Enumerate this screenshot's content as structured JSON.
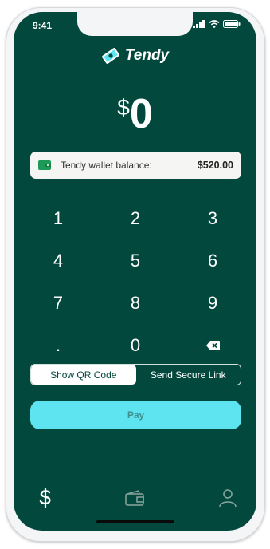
{
  "status_bar": {
    "time": "9:41"
  },
  "brand": {
    "name": "Tendy",
    "logo_icon": "dollar-note-icon"
  },
  "amount": {
    "currency_symbol": "$",
    "value": "0"
  },
  "wallet": {
    "label": "Tendy wallet balance:",
    "balance": "$520.00",
    "icon": "wallet-icon"
  },
  "keypad": {
    "keys": [
      "1",
      "2",
      "3",
      "4",
      "5",
      "6",
      "7",
      "8",
      "9",
      ".",
      "0"
    ],
    "delete_icon": "backspace-icon"
  },
  "payment_method": {
    "options": [
      "Show QR Code",
      "Send Secure Link"
    ],
    "selected": "Show QR Code"
  },
  "pay_button": {
    "label": "Pay"
  },
  "tab_bar": {
    "tabs": [
      {
        "name": "pay",
        "icon": "dollar-icon",
        "active": true
      },
      {
        "name": "wallet",
        "icon": "wallet-icon",
        "active": false
      },
      {
        "name": "profile",
        "icon": "user-icon",
        "active": false
      }
    ]
  },
  "colors": {
    "background": "#03483d",
    "accent": "#5ee3f0",
    "card": "#f5f5f3",
    "wallet_icon": "#1e9a58"
  }
}
